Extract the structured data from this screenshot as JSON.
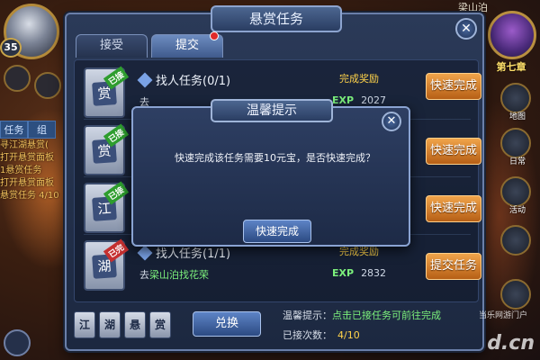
{
  "hud": {
    "level": "35",
    "location": "梁山泊",
    "chapter_label": "第七章",
    "left_tabs": [
      "任务",
      "组"
    ],
    "quest_log": [
      "寻江湖悬赏(",
      "打开悬赏面板",
      "1悬赏任务",
      "打开悬赏面板",
      "悬赏任务 4/10"
    ],
    "right_icons": [
      {
        "name": "map",
        "label": "地图"
      },
      {
        "name": "sign-in",
        "label": "日常"
      },
      {
        "name": "activity",
        "label": "活动"
      },
      {
        "name": "skill",
        "label": ""
      },
      {
        "name": "bag",
        "label": ""
      }
    ]
  },
  "panel": {
    "title": "悬赏任务",
    "tabs": [
      {
        "label": "接受",
        "active": false
      },
      {
        "label": "提交",
        "active": true,
        "has_dot": true
      }
    ],
    "quests": [
      {
        "card_glyph": "赏",
        "tag": "已接",
        "tag_color": "green",
        "title": "找人任务(0/1)",
        "reward_label": "完成奖励",
        "desc_prefix": "去",
        "desc_highlight": "",
        "desc_suffix": "",
        "exp": "2027",
        "button": "快速完成"
      },
      {
        "card_glyph": "赏",
        "tag": "已接",
        "tag_color": "green",
        "title": "",
        "reward_label": "",
        "desc_prefix": "",
        "desc_highlight": "",
        "desc_suffix": "",
        "exp": "",
        "button": "快速完成"
      },
      {
        "card_glyph": "江",
        "tag": "已接",
        "tag_color": "green",
        "title": "",
        "reward_label": "",
        "desc_prefix": "",
        "desc_highlight": "",
        "desc_suffix": "",
        "exp": "",
        "button": "快速完成"
      },
      {
        "card_glyph": "湖",
        "tag": "已完",
        "tag_color": "red",
        "title": "找人任务(1/1)",
        "reward_label": "完成奖励",
        "desc_prefix": "去",
        "desc_highlight": "梁山泊找花荣",
        "desc_suffix": "",
        "exp": "2832",
        "button": "提交任务"
      }
    ],
    "mini_cards": [
      "江",
      "湖",
      "悬",
      "赏"
    ],
    "swap_label": "兑换",
    "tip_label": "温馨提示：",
    "tip_value": "点击已接任务可前往完成",
    "count_label": "已接次数：",
    "count_value": "4/10"
  },
  "dialog": {
    "title": "温馨提示",
    "message": "快速完成该任务需要10元宝，是否快速完成？",
    "confirm_label": "快速完成"
  },
  "watermark": {
    "sub": "当乐网游门户",
    "main": "d.cn"
  }
}
